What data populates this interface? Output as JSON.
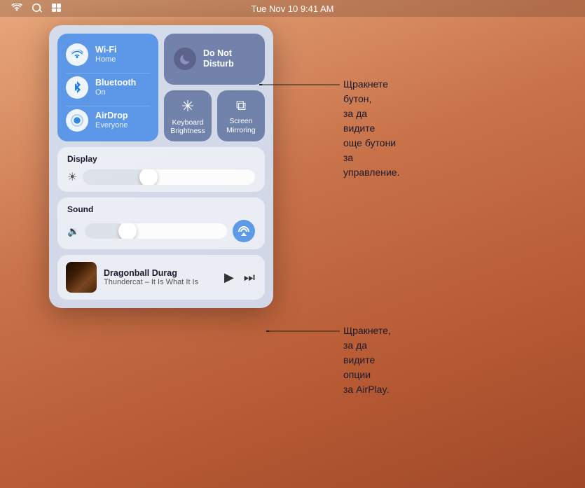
{
  "menubar": {
    "time": "Tue Nov 10  9:41 AM"
  },
  "network": {
    "wifi": {
      "name": "Wi-Fi",
      "sub": "Home"
    },
    "bluetooth": {
      "name": "Bluetooth",
      "sub": "On"
    },
    "airdrop": {
      "name": "AirDrop",
      "sub": "Everyone"
    }
  },
  "dnd": {
    "label": "Do Not\nDisturb"
  },
  "small_buttons": [
    {
      "label": "Keyboard\nBrightness",
      "icon": "✳"
    },
    {
      "label": "Screen\nMirroring",
      "icon": "⊡"
    }
  ],
  "display": {
    "label": "Display",
    "slider_pct": 38
  },
  "sound": {
    "label": "Sound",
    "slider_pct": 30
  },
  "now_playing": {
    "title": "Dragonball Durag",
    "artist": "Thundercat – It Is What It Is"
  },
  "annotations": {
    "first": "Щракнете бутон,\nза да видите\nоще бутони за\nуправление.",
    "second": "Щракнете, за да\nвидите опции\nза AirPlay."
  }
}
